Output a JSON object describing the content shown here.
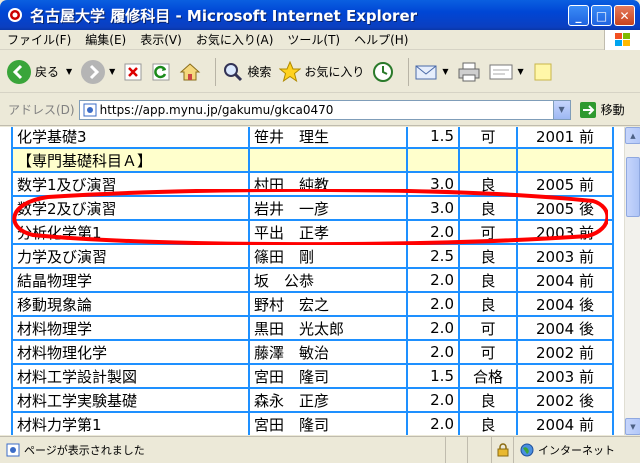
{
  "window": {
    "title": "名古屋大学 履修科目 - Microsoft Internet Explorer",
    "btn_minimize": "_",
    "btn_maximize": "□",
    "btn_close": "✕"
  },
  "menu": [
    "ファイル(F)",
    "編集(E)",
    "表示(V)",
    "お気に入り(A)",
    "ツール(T)",
    "ヘルプ(H)"
  ],
  "toolbar": {
    "back_label": "戻る",
    "search_label": "検索",
    "favorites_label": "お気に入り"
  },
  "address": {
    "label": "アドレス(D)",
    "url": "https://app.mynu.jp/gakumu/gkca0470",
    "go_label": "移動"
  },
  "courses": [
    {
      "name": "化学基礎3",
      "teacher": "笹井　理生",
      "credit": "1.5",
      "grade": "可",
      "year": "2001 前"
    },
    {
      "section": "【専門基礎科目Ａ】"
    },
    {
      "name": "数学1及び演習",
      "teacher": "村田　純教",
      "credit": "3.0",
      "grade": "良",
      "year": "2005 前"
    },
    {
      "name": "数学2及び演習",
      "teacher": "岩井　一彦",
      "credit": "3.0",
      "grade": "良",
      "year": "2005 後"
    },
    {
      "name": "分析化学第1",
      "teacher": "平出　正孝",
      "credit": "2.0",
      "grade": "可",
      "year": "2003 前"
    },
    {
      "name": "力学及び演習",
      "teacher": "篠田　剛",
      "credit": "2.5",
      "grade": "良",
      "year": "2003 前"
    },
    {
      "name": "結晶物理学",
      "teacher": "坂　公恭",
      "credit": "2.0",
      "grade": "良",
      "year": "2004 前"
    },
    {
      "name": "移動現象論",
      "teacher": "野村　宏之",
      "credit": "2.0",
      "grade": "良",
      "year": "2004 後"
    },
    {
      "name": "材料物理学",
      "teacher": "黒田　光太郎",
      "credit": "2.0",
      "grade": "可",
      "year": "2004 後"
    },
    {
      "name": "材料物理化学",
      "teacher": "藤澤　敏治",
      "credit": "2.0",
      "grade": "可",
      "year": "2002 前"
    },
    {
      "name": "材料工学設計製図",
      "teacher": "宮田　隆司",
      "credit": "1.5",
      "grade": "合格",
      "year": "2003 前"
    },
    {
      "name": "材料工学実験基礎",
      "teacher": "森永　正彦",
      "credit": "2.0",
      "grade": "良",
      "year": "2002 後"
    },
    {
      "name": "材料力学第1",
      "teacher": "宮田　隆司",
      "credit": "2.0",
      "grade": "良",
      "year": "2004 前"
    }
  ],
  "status": {
    "message": "ページが表示されました",
    "zone": "インターネット"
  },
  "colors": {
    "table_border": "#1e90ff",
    "section_bg": "#ffffcc",
    "highlight": "#ff0000"
  }
}
